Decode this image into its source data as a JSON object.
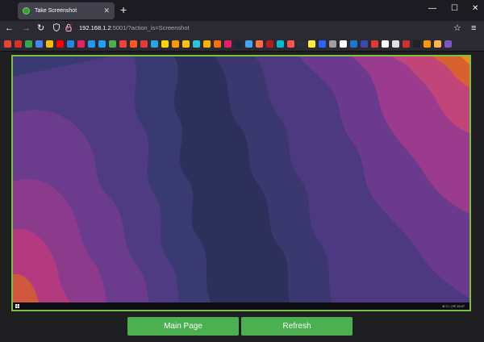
{
  "browser": {
    "tab": {
      "title": "Take Screenshot",
      "close_glyph": "✕"
    },
    "new_tab_glyph": "+",
    "window_controls": {
      "minimize": "—",
      "maximize": "☐",
      "close": "✕"
    },
    "nav": {
      "back": "←",
      "forward": "→",
      "reload": "↻",
      "menu": "≡",
      "bookmark_star": "☆"
    },
    "url": {
      "host": "192.168.1.2",
      "path": ":5001/?action_is=Screenshot"
    },
    "bookmark_colors": [
      "#ea4335",
      "#d93025",
      "#34a853",
      "#4285f4",
      "#fbbc04",
      "#ff0000",
      "#1e88e5",
      "#e91e63",
      "#2196f3",
      "#1da1f2",
      "#4caf50",
      "#f44336",
      "#ff5722",
      "#e53935",
      "#26a5e4",
      "#ffd600",
      "#ff9800",
      "#ffc107",
      "#26c6da",
      "#ffb300",
      "#ff6f00",
      "#e91e63",
      "#1b2838",
      "#42a5f5",
      "#ff7043",
      "#b71c1c",
      "#00bcd4",
      "#ff5252",
      "#263238",
      "#ffeb3b",
      "#2962ff",
      "#9e9e9e",
      "#ffffff",
      "#1976d2",
      "#3949ab",
      "#e53935",
      "#ffffff",
      "#e0e0e0",
      "#d32f2f",
      "#212121",
      "#ff9800",
      "#ffb74d",
      "#7e57c2"
    ]
  },
  "desktop": {
    "tray_text": "⊕ ☐ ◁ ✉ 19:47"
  },
  "buttons": {
    "main_page": "Main Page",
    "refresh": "Refresh"
  },
  "colors": {
    "accent": "#4caf50",
    "frame_border": "#7bc043"
  }
}
